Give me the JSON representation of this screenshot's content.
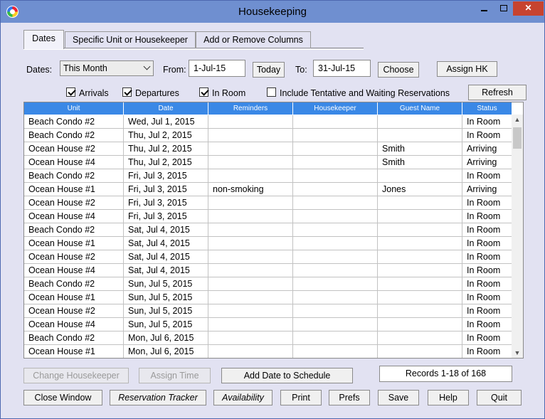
{
  "window": {
    "title": "Housekeeping"
  },
  "tabs": [
    {
      "label": "Dates",
      "active": true
    },
    {
      "label": "Specific Unit or Housekeeper",
      "active": false
    },
    {
      "label": "Add or Remove Columns",
      "active": false
    }
  ],
  "filters": {
    "dates_label": "Dates:",
    "dates_value": "This Month",
    "from_label": "From:",
    "from_value": "1-Jul-15",
    "today_label": "Today",
    "to_label": "To:",
    "to_value": "31-Jul-15",
    "choose_label": "Choose",
    "assign_hk_label": "Assign HK",
    "refresh_label": "Refresh",
    "arrivals_label": "Arrivals",
    "departures_label": "Departures",
    "inroom_label": "In Room",
    "tentative_label": "Include Tentative and Waiting Reservations"
  },
  "table": {
    "columns": [
      "Unit",
      "Date",
      "Reminders",
      "Housekeeper",
      "Guest Name",
      "Status"
    ],
    "rows": [
      [
        "Beach Condo #2",
        "Wed, Jul 1, 2015",
        "",
        "",
        "",
        "In Room"
      ],
      [
        "Beach Condo #2",
        "Thu, Jul 2, 2015",
        "",
        "",
        "",
        "In Room"
      ],
      [
        "Ocean House #2",
        "Thu, Jul 2, 2015",
        "",
        "",
        "Smith",
        "Arriving"
      ],
      [
        "Ocean House #4",
        "Thu, Jul 2, 2015",
        "",
        "",
        "Smith",
        "Arriving"
      ],
      [
        "Beach Condo #2",
        "Fri, Jul 3, 2015",
        "",
        "",
        "",
        "In Room"
      ],
      [
        "Ocean House #1",
        "Fri, Jul 3, 2015",
        "non-smoking",
        "",
        "Jones",
        "Arriving"
      ],
      [
        "Ocean House #2",
        "Fri, Jul 3, 2015",
        "",
        "",
        "",
        "In Room"
      ],
      [
        "Ocean House #4",
        "Fri, Jul 3, 2015",
        "",
        "",
        "",
        "In Room"
      ],
      [
        "Beach Condo #2",
        "Sat, Jul 4, 2015",
        "",
        "",
        "",
        "In Room"
      ],
      [
        "Ocean House #1",
        "Sat, Jul 4, 2015",
        "",
        "",
        "",
        "In Room"
      ],
      [
        "Ocean House #2",
        "Sat, Jul 4, 2015",
        "",
        "",
        "",
        "In Room"
      ],
      [
        "Ocean House #4",
        "Sat, Jul 4, 2015",
        "",
        "",
        "",
        "In Room"
      ],
      [
        "Beach Condo #2",
        "Sun, Jul 5, 2015",
        "",
        "",
        "",
        "In Room"
      ],
      [
        "Ocean House #1",
        "Sun, Jul 5, 2015",
        "",
        "",
        "",
        "In Room"
      ],
      [
        "Ocean House #2",
        "Sun, Jul 5, 2015",
        "",
        "",
        "",
        "In Room"
      ],
      [
        "Ocean House #4",
        "Sun, Jul 5, 2015",
        "",
        "",
        "",
        "In Room"
      ],
      [
        "Beach Condo #2",
        "Mon, Jul 6, 2015",
        "",
        "",
        "",
        "In Room"
      ],
      [
        "Ocean House #1",
        "Mon, Jul 6, 2015",
        "",
        "",
        "",
        "In Room"
      ]
    ]
  },
  "actions": {
    "change_housekeeper": "Change Housekeeper",
    "assign_time": "Assign Time",
    "add_date": "Add Date to Schedule",
    "records": "Records 1-18 of 168",
    "close_window": "Close Window",
    "reservation_tracker": "Reservation Tracker",
    "availability": "Availability",
    "print": "Print",
    "prefs": "Prefs",
    "save": "Save",
    "help": "Help",
    "quit": "Quit"
  }
}
